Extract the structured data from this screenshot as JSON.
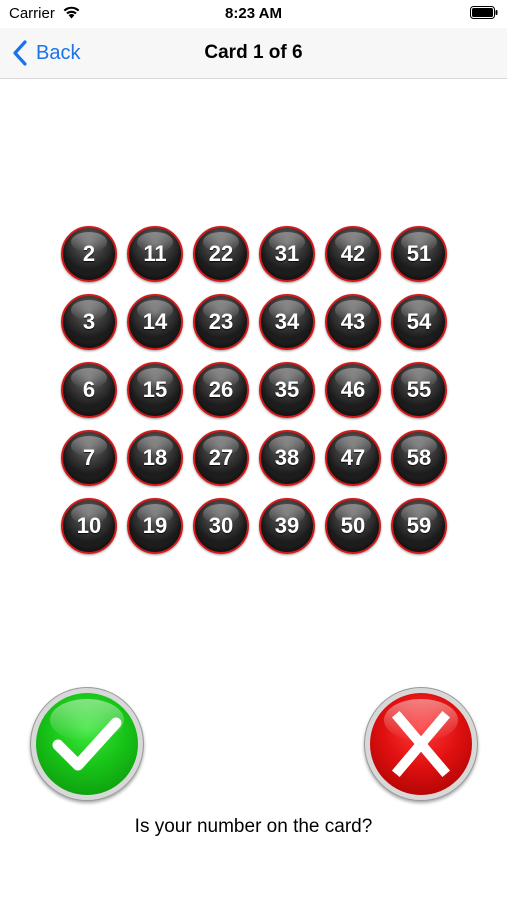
{
  "status_bar": {
    "carrier": "Carrier",
    "time": "8:23 AM"
  },
  "nav": {
    "back_label": "Back",
    "title": "Card 1 of 6"
  },
  "card": {
    "numbers": [
      [
        "2",
        "11",
        "22",
        "31",
        "42",
        "51"
      ],
      [
        "3",
        "14",
        "23",
        "34",
        "43",
        "54"
      ],
      [
        "6",
        "15",
        "26",
        "35",
        "46",
        "55"
      ],
      [
        "7",
        "18",
        "27",
        "38",
        "47",
        "58"
      ],
      [
        "10",
        "19",
        "30",
        "39",
        "50",
        "59"
      ]
    ]
  },
  "answers": {
    "yes_icon": "checkmark-icon",
    "no_icon": "x-icon"
  },
  "question": "Is your number on the card?",
  "colors": {
    "accent": "#1a73e8",
    "ball_border": "#d21a1a",
    "yes": "#18c418",
    "no": "#e01010"
  }
}
